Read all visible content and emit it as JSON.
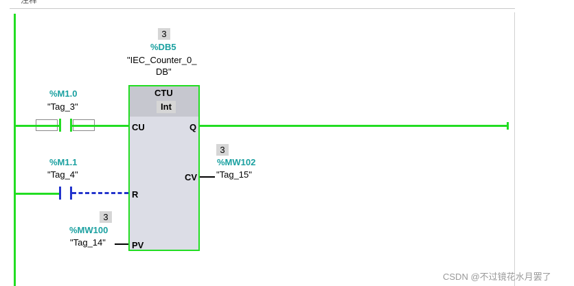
{
  "header": {
    "title": "注释"
  },
  "counter": {
    "instance_value": "3",
    "instance_address": "%DB5",
    "instance_name_line1": "\"IEC_Counter_0_",
    "instance_name_line2": "DB\"",
    "type": "CTU",
    "data_type": "Int",
    "pins": {
      "cu": "CU",
      "q": "Q",
      "cv": "CV",
      "r": "R",
      "pv": "PV"
    }
  },
  "contact_cu": {
    "address": "%M1.0",
    "symbol": "\"Tag_3\""
  },
  "contact_r": {
    "address": "%M1.1",
    "symbol": "\"Tag_4\""
  },
  "cv_output": {
    "value": "3",
    "address": "%MW102",
    "symbol": "\"Tag_15\""
  },
  "pv_input": {
    "value": "3",
    "address": "%MW100",
    "symbol": "\"Tag_14\""
  },
  "watermark": "CSDN @不过镜花水月罢了",
  "colors": {
    "power_flow": "#22dd22",
    "no_power": "#2233cc",
    "address": "#1aa0a0"
  }
}
